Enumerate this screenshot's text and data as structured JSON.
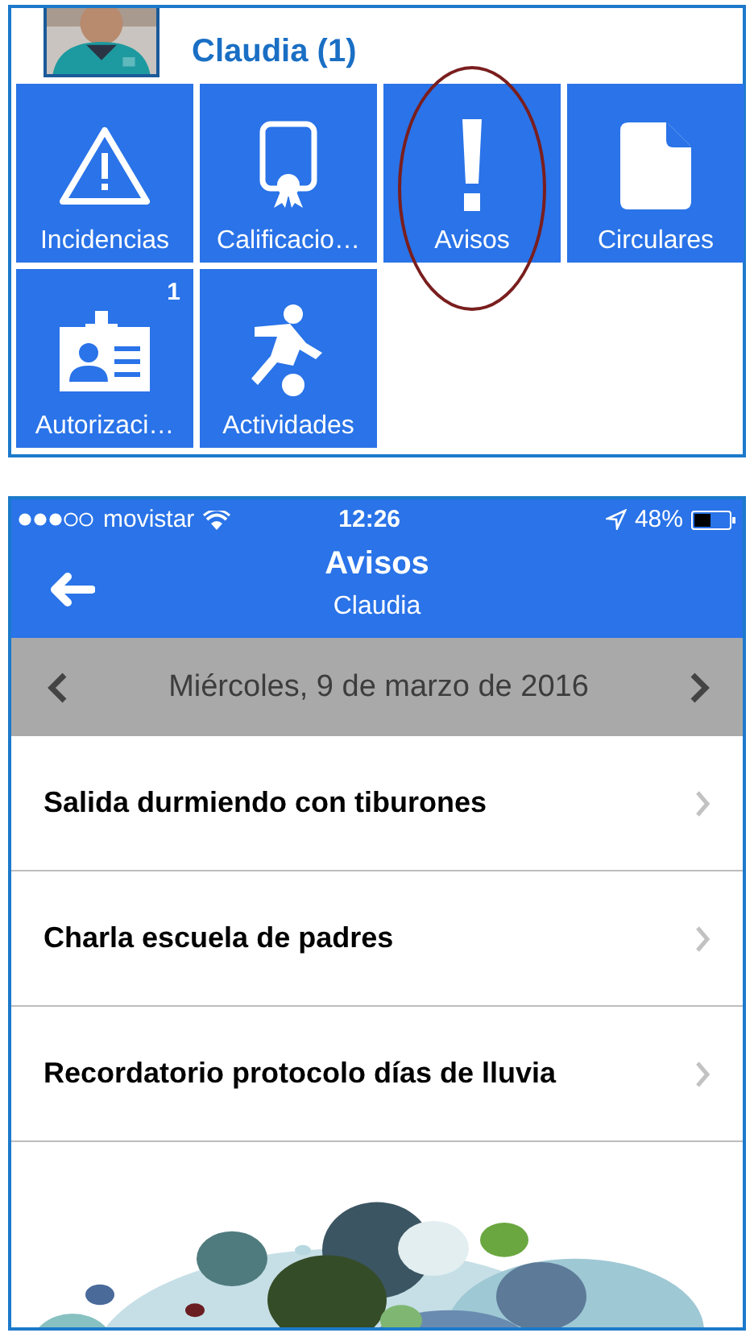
{
  "student_panel": {
    "name": "Claudia (1)",
    "tiles": [
      {
        "label": "Incidencias",
        "highlighted": false
      },
      {
        "label": "Calificacio…",
        "highlighted": false
      },
      {
        "label": "Avisos",
        "highlighted": true
      },
      {
        "label": "Circulares",
        "highlighted": false
      },
      {
        "label": "Autorizaci…",
        "badge": "1",
        "highlighted": false
      },
      {
        "label": "Actividades",
        "highlighted": false
      }
    ]
  },
  "phone": {
    "status_bar": {
      "carrier": "movistar",
      "time": "12:26",
      "battery": "48%"
    },
    "nav": {
      "title": "Avisos",
      "subtitle": "Claudia"
    },
    "date_bar": {
      "date": "Miércoles, 9 de marzo de 2016"
    },
    "notices": [
      {
        "title": "Salida durmiendo con tiburones"
      },
      {
        "title": "Charla escuela de padres"
      },
      {
        "title": "Recordatorio protocolo días de lluvia"
      }
    ]
  }
}
